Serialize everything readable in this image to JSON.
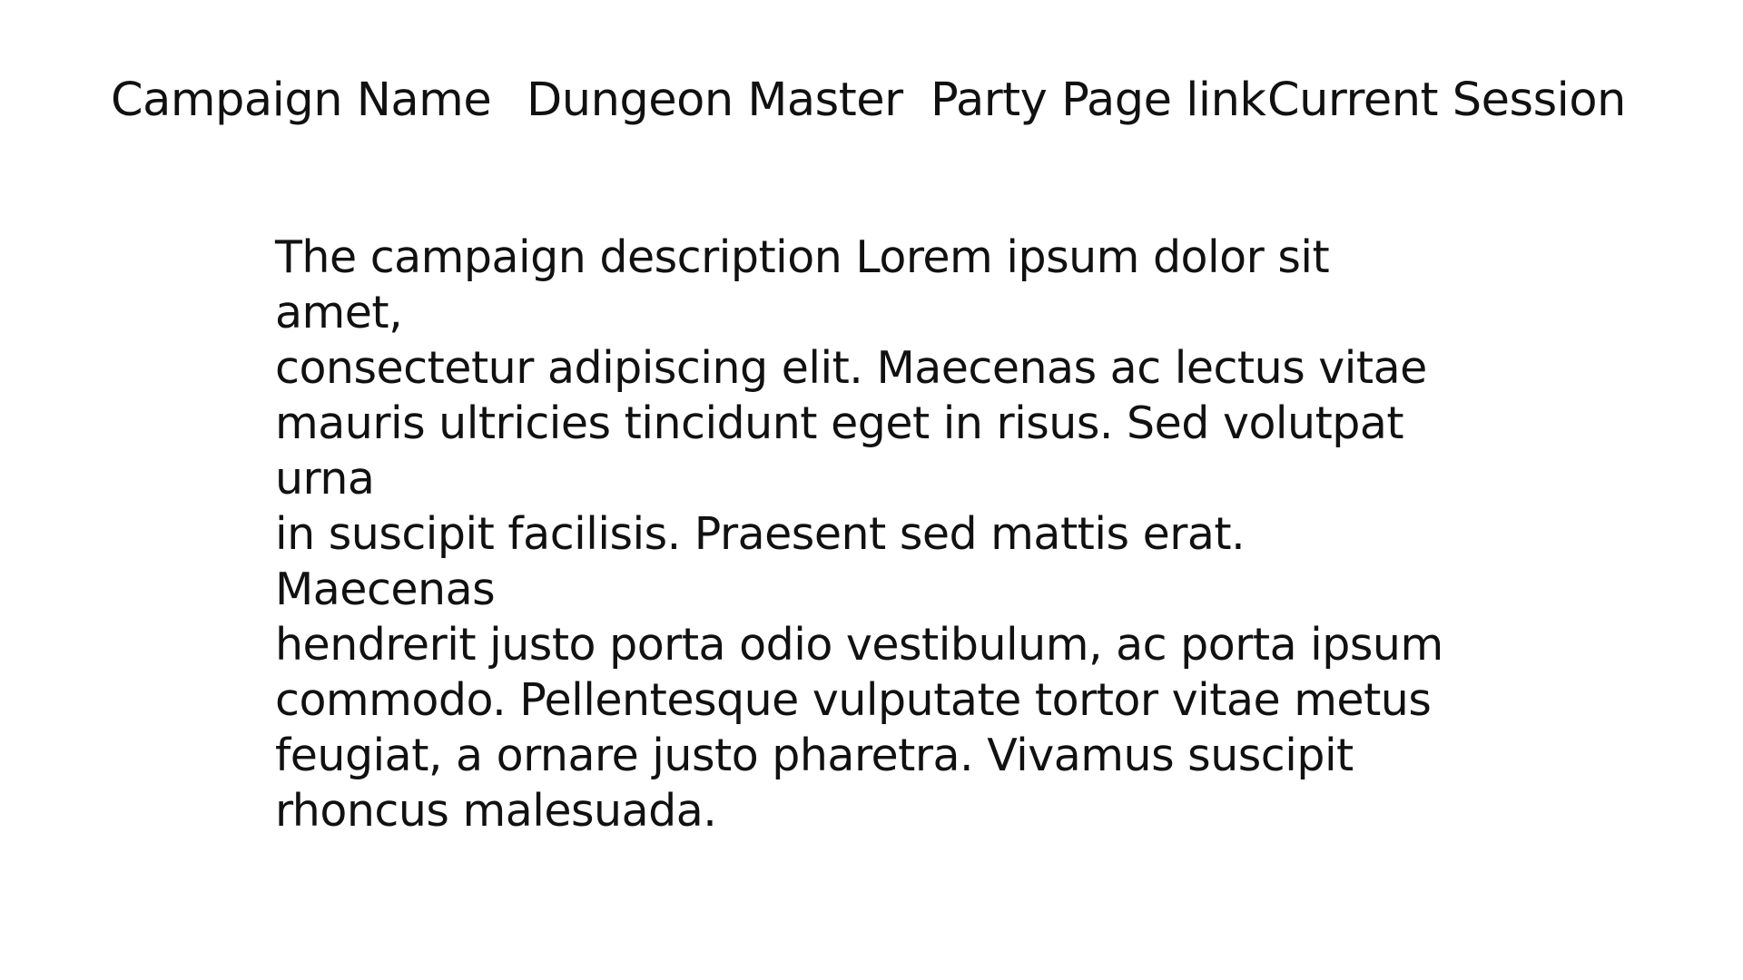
{
  "header": {
    "campaign_name": "Campaign Name",
    "dungeon_master": "Dungeon Master",
    "party_page_link": "Party Page link",
    "current_session": "Current Session"
  },
  "main": {
    "description_lines": [
      "The campaign description Lorem ipsum dolor sit amet,",
      "consectetur adipiscing elit. Maecenas ac lectus vitae",
      "mauris ultricies tincidunt eget in risus. Sed volutpat urna",
      "in suscipit facilisis. Praesent sed mattis erat. Maecenas",
      "hendrerit justo porta odio vestibulum, ac porta ipsum",
      "commodo. Pellentesque vulputate tortor vitae metus",
      "feugiat, a ornare justo pharetra. Vivamus suscipit",
      "rhoncus malesuada."
    ]
  },
  "colors": {
    "background": "#ffffff",
    "text": "#111111"
  }
}
